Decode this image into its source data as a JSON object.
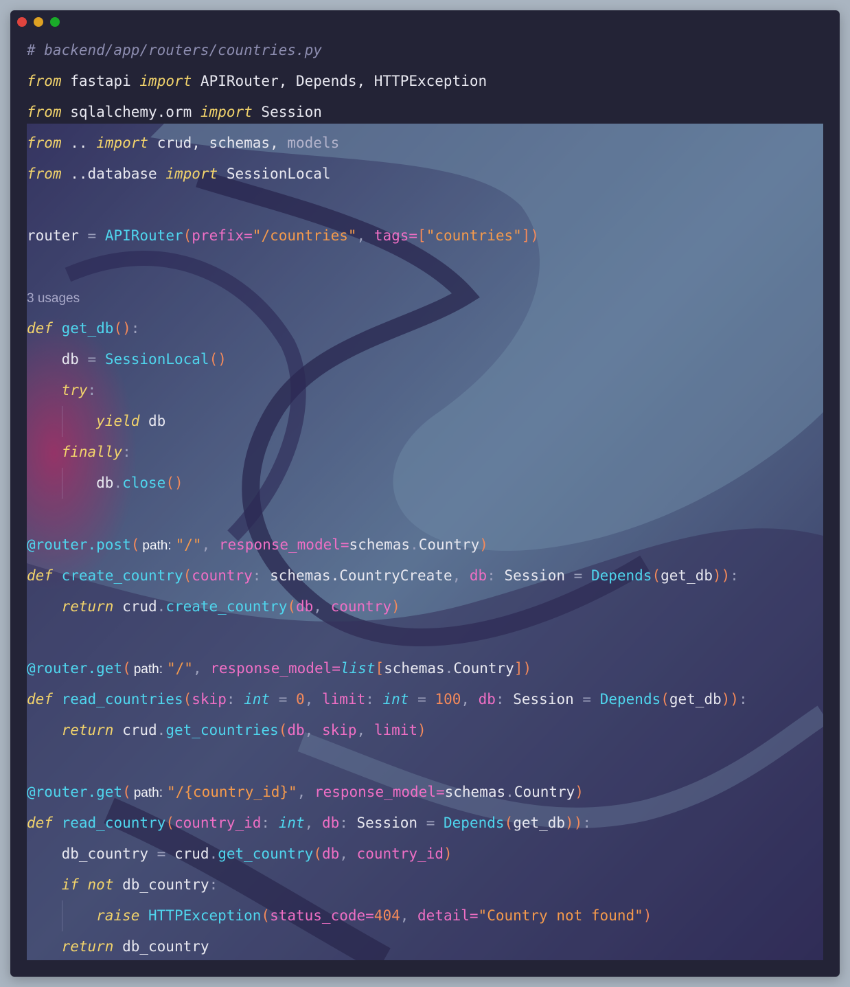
{
  "window": {
    "controls": [
      "close",
      "minimize",
      "maximize"
    ]
  },
  "code": {
    "comment": "# backend/app/routers/countries.py",
    "usages": "3 usages",
    "hint_path": "path:",
    "lines": {
      "imp1_from": "from",
      "imp1_mod": "fastapi",
      "imp1_import": "import",
      "imp1_names": "APIRouter, Depends, HTTPException",
      "imp2_from": "from",
      "imp2_mod": "sqlalchemy.orm",
      "imp2_import": "import",
      "imp2_names": "Session",
      "imp3_from": "from",
      "imp3_mod": "..",
      "imp3_import": "import",
      "imp3_names": "crud, schemas,",
      "imp3_unused": "models",
      "imp4_from": "from",
      "imp4_mod": "..database",
      "imp4_import": "import",
      "imp4_names": "SessionLocal",
      "router_decl": "router",
      "router_call": "APIRouter",
      "router_prefix_kw": "prefix",
      "router_prefix_val": "\"/countries\"",
      "router_tags_kw": "tags",
      "router_tags_val": "\"countries\"",
      "def_kw": "def",
      "getdb_name": "get_db",
      "db_var": "db",
      "sessionlocal": "SessionLocal",
      "try_kw": "try",
      "yield_kw": "yield",
      "finally_kw": "finally",
      "close_fn": "close",
      "dec_post": "@router.post",
      "dec_get": "@router.get",
      "slash_str": "\"/\"",
      "id_str": "\"/{country_id}\"",
      "response_model_kw": "response_model",
      "schemas_country": "schemas",
      "country_cls": "Country",
      "create_fn": "create_country",
      "country_param": "country",
      "country_create_type": "schemas.CountryCreate",
      "session_type": "Session",
      "depends_fn": "Depends",
      "return_kw": "return",
      "crud": "crud",
      "list_type": "list",
      "read_countries_fn": "read_countries",
      "skip_param": "skip",
      "int_type": "int",
      "zero": "0",
      "limit_param": "limit",
      "hundred": "100",
      "get_countries_fn": "get_countries",
      "read_country_fn": "read_country",
      "country_id_param": "country_id",
      "db_country_var": "db_country",
      "get_country_fn": "get_country",
      "if_kw": "if",
      "not_kw": "not",
      "raise_kw": "raise",
      "http_exc": "HTTPException",
      "status_code_kw": "status_code",
      "status_val": "404",
      "detail_kw": "detail",
      "detail_val": "\"Country not found\""
    }
  },
  "colors": {
    "background": "#aab5c1",
    "editor": "#232336",
    "keyword": "#f2d36b",
    "function": "#4fd6ee",
    "string": "#f59a4c",
    "parameter": "#f06fc5"
  }
}
